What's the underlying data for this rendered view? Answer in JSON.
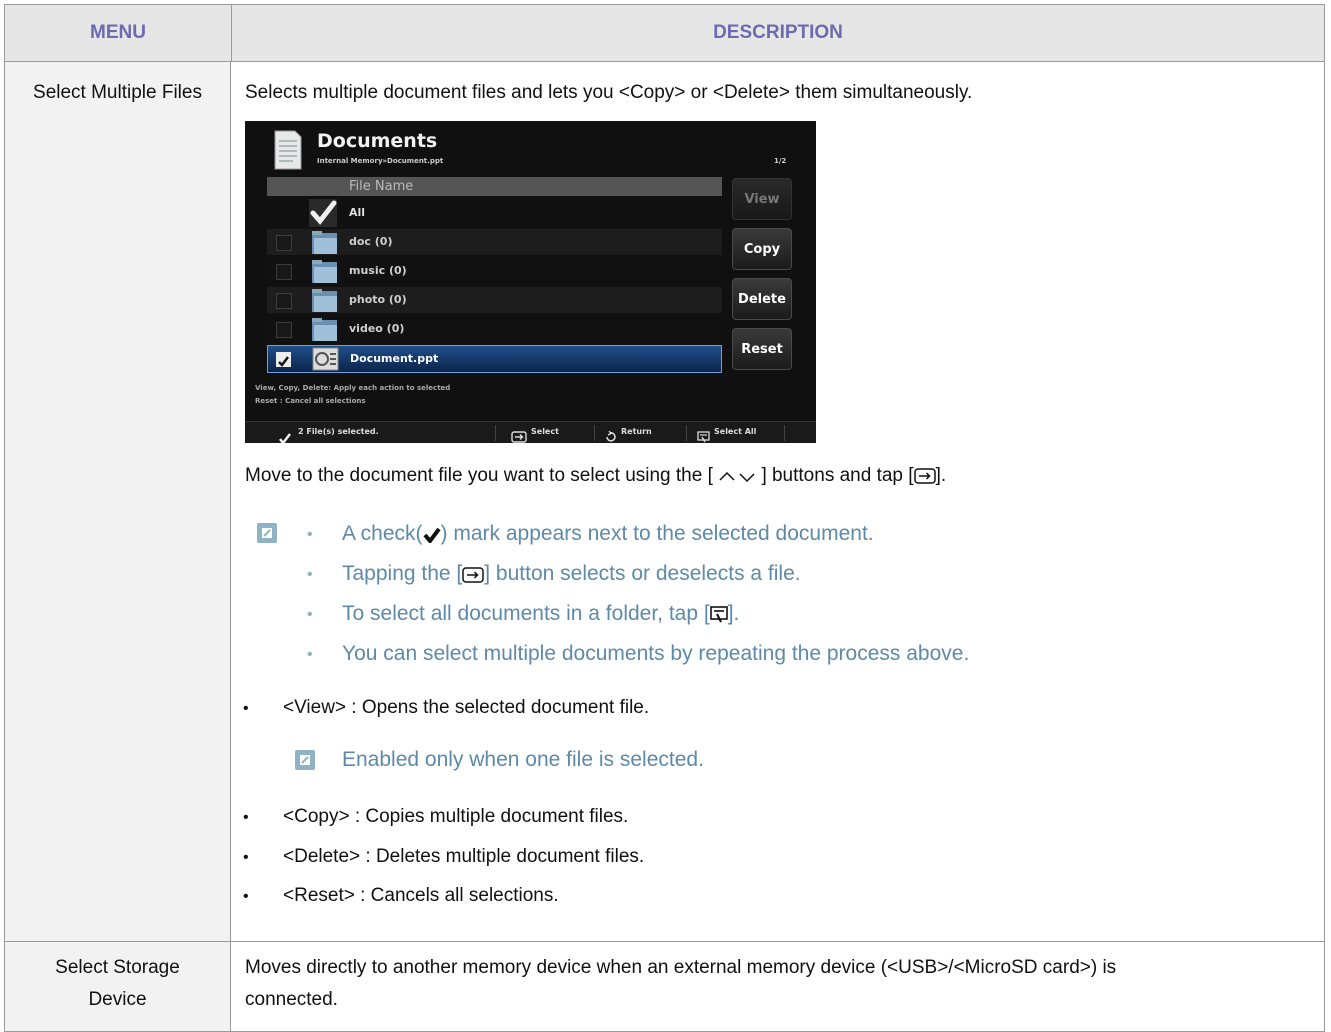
{
  "table": {
    "headers": {
      "menu": "MENU",
      "description": "DESCRIPTION"
    },
    "rows": [
      {
        "menu": "Select Multiple Files",
        "intro": "Selects multiple document files and lets you <Copy> or <Delete> them simultaneously.",
        "move_text_a": "Move to the document file you want to select using the [",
        "move_text_b": "] buttons and tap [",
        "move_text_c": "].",
        "notes": {
          "line1_a": "A check(",
          "line1_b": ") mark appears next to the selected document.",
          "line2_a": "Tapping the [",
          "line2_b": "] button selects or deselects a file.",
          "line3_a": "To select all documents in a folder, tap [",
          "line3_b": "].",
          "line4": "You can select multiple documents by repeating the process above."
        },
        "view_item": "<View> : Opens the selected document file.",
        "view_note": "Enabled only when one file is selected.",
        "copy_item": "<Copy> : Copies multiple document files.",
        "delete_item": "<Delete> : Deletes multiple document files.",
        "reset_item": "<Reset> : Cancels all selections."
      },
      {
        "menu_line1": "Select Storage",
        "menu_line2": "Device",
        "desc_line1": "Moves directly to another memory device when an external memory device (<USB>/<MicroSD card>) is",
        "desc_line2": "connected."
      }
    ]
  },
  "screenshot": {
    "title": "Documents",
    "path": "Internal Memory»Document.ppt",
    "page": "1/2",
    "column_header": "File Name",
    "all_label": "All",
    "files": [
      {
        "name": "doc (0)",
        "type": "folder",
        "checked": false
      },
      {
        "name": "music (0)",
        "type": "folder",
        "checked": false
      },
      {
        "name": "photo (0)",
        "type": "folder",
        "checked": false
      },
      {
        "name": "video (0)",
        "type": "folder",
        "checked": false
      },
      {
        "name": "Document.ppt",
        "type": "document",
        "checked": true
      }
    ],
    "buttons": {
      "view": "View",
      "copy": "Copy",
      "delete": "Delete",
      "reset": "Reset"
    },
    "help1": "View, Copy, Delete: Apply each action to selected",
    "help2": "Reset : Cancel all selections",
    "status": "2 File(s) selected.",
    "footer": {
      "select": "Select",
      "return": "Return",
      "select_all": "Select All"
    }
  }
}
